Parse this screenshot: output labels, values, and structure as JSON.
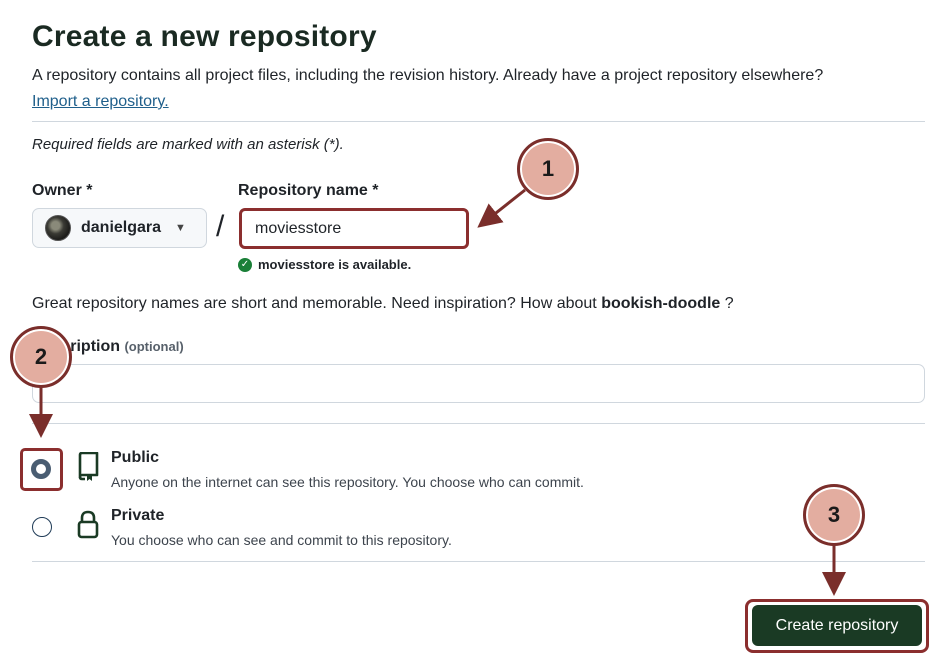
{
  "header": {
    "title": "Create a new repository",
    "intro": "A repository contains all project files, including the revision history. Already have a project repository elsewhere?",
    "import_link": "Import a repository."
  },
  "form": {
    "required_note": "Required fields are marked with an asterisk (*).",
    "owner_label": "Owner *",
    "owner_value": "danielgara",
    "slash": "/",
    "repo_name_label": "Repository name *",
    "repo_name_value": "moviesstore",
    "availability": "moviesstore is available.",
    "suggestion_prefix": "Great repository names are short and memorable. Need inspiration? How about",
    "suggestion_name": "bookish-doodle",
    "suggestion_suffix": "?",
    "description_label": "Description",
    "description_visible": "ription",
    "description_optional": "(optional)",
    "visibility": [
      {
        "title": "Public",
        "subtitle": "Anyone on the internet can see this repository. You choose who can commit.",
        "selected": true,
        "icon": "repo-icon"
      },
      {
        "title": "Private",
        "subtitle": "You choose who can see and commit to this repository.",
        "selected": false,
        "icon": "lock-icon"
      }
    ],
    "submit_label": "Create repository"
  },
  "callouts": [
    "1",
    "2",
    "3"
  ],
  "colors": {
    "callout_fill": "#e3ada0",
    "callout_border": "#7a2e2b",
    "highlight": "#8b2e2e",
    "primary_button": "#1a3a24",
    "success": "#1a7f37"
  }
}
